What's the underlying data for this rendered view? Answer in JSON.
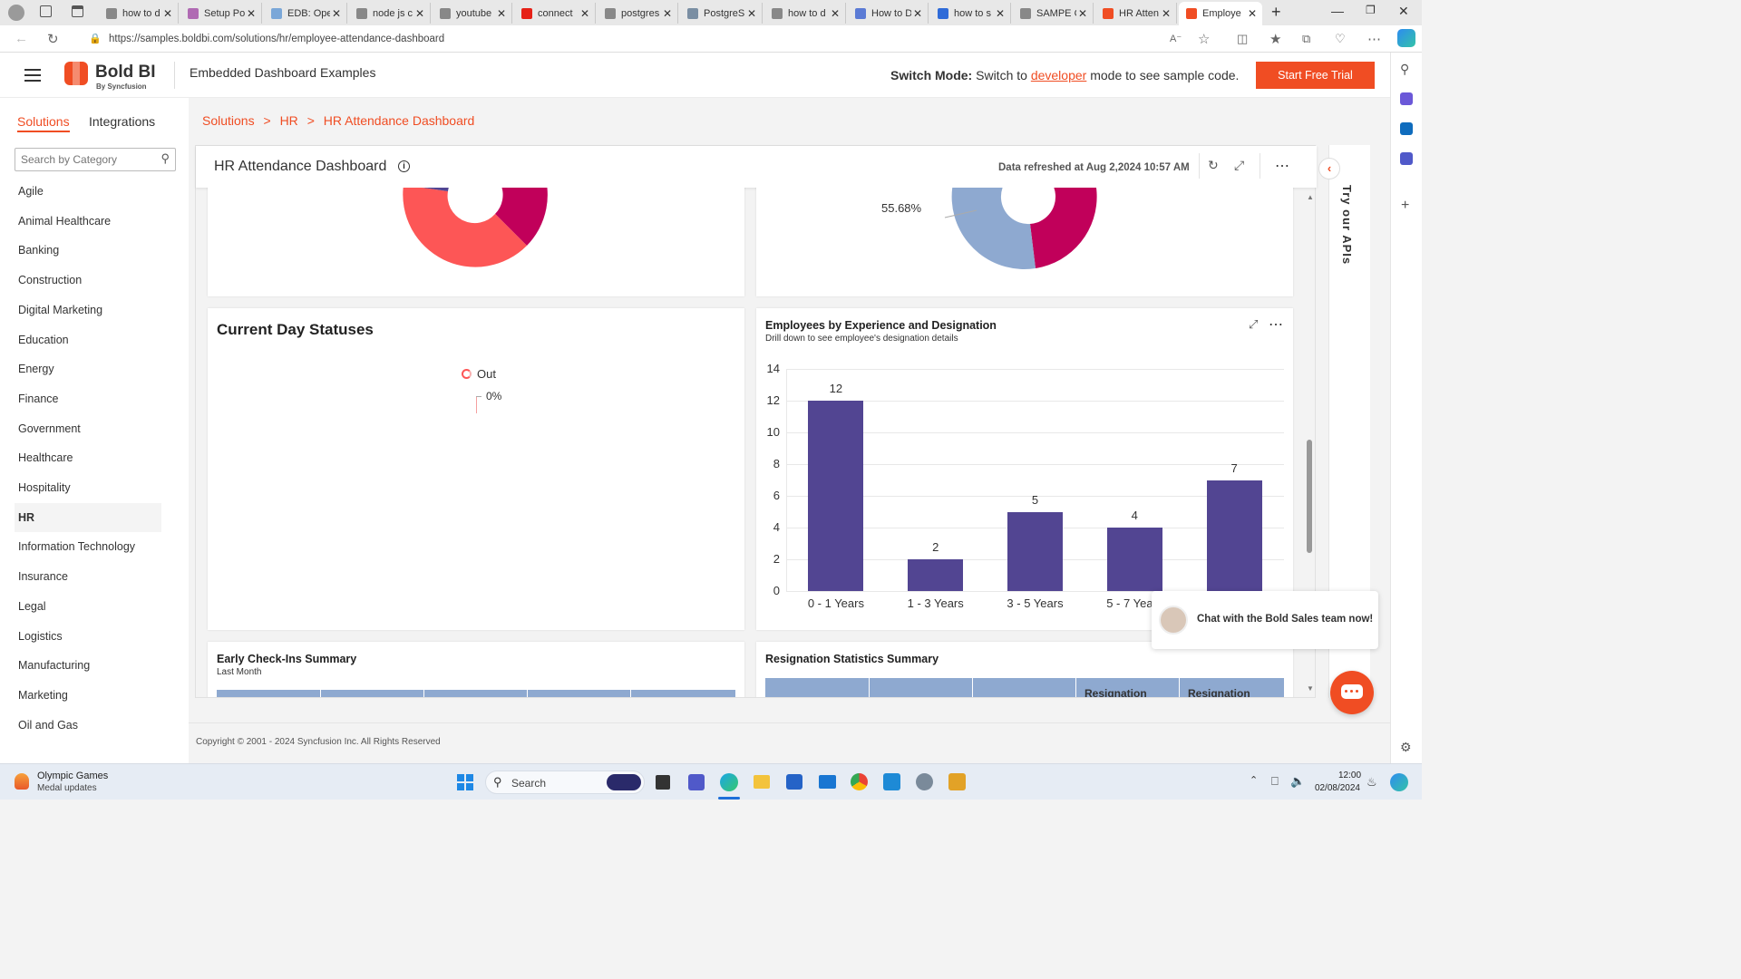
{
  "browser": {
    "tabs": [
      {
        "title": "how to d",
        "color": "#888"
      },
      {
        "title": "Setup Po",
        "color": "#b06ab3"
      },
      {
        "title": "EDB: Ope",
        "color": "#7aa7d8"
      },
      {
        "title": "node js c",
        "color": "#888"
      },
      {
        "title": "youtube",
        "color": "#888"
      },
      {
        "title": "connect",
        "color": "#e62117"
      },
      {
        "title": "postgres",
        "color": "#888"
      },
      {
        "title": "PostgreS",
        "color": "#7a8ea3"
      },
      {
        "title": "how to d",
        "color": "#888"
      },
      {
        "title": "How to D",
        "color": "#5b7bd5"
      },
      {
        "title": "how to s",
        "color": "#2f6bd8"
      },
      {
        "title": "SAMPE C",
        "color": "#888"
      },
      {
        "title": "HR Atten",
        "color": "#f04d23"
      },
      {
        "title": "Employe",
        "color": "#f04d23"
      }
    ],
    "url": "https://samples.boldbi.com/solutions/hr/employee-attendance-dashboard"
  },
  "header": {
    "brand": "Bold BI",
    "brand_sub": "By Syncfusion",
    "title": "Embedded Dashboard Examples",
    "switch_label": "Switch Mode:",
    "switch_pre": "Switch to",
    "switch_link": "developer",
    "switch_post": "mode to see sample code.",
    "cta": "Start Free Trial"
  },
  "sidebar": {
    "tabs": [
      "Solutions",
      "Integrations"
    ],
    "search_placeholder": "Search by Category",
    "items": [
      "Agile",
      "Animal Healthcare",
      "Banking",
      "Construction",
      "Digital Marketing",
      "Education",
      "Energy",
      "Finance",
      "Government",
      "Healthcare",
      "Hospitality",
      "HR",
      "Information Technology",
      "Insurance",
      "Legal",
      "Logistics",
      "Manufacturing",
      "Marketing",
      "Oil and Gas"
    ],
    "active_index": 11
  },
  "breadcrumb": {
    "items": [
      "Solutions",
      "HR",
      "HR Attendance Dashboard"
    ],
    "sep": ">"
  },
  "dashboard": {
    "title": "HR Attendance Dashboard",
    "refreshed": "Data refreshed at Aug 2,2024 10:57 AM",
    "side_tab": "Try our APIs",
    "right_donut_label": "55.68%",
    "current_day": {
      "title": "Current Day Statuses",
      "legend": "Out",
      "value": "0%"
    },
    "experience": {
      "title": "Employees by Experience and Designation",
      "subtitle": "Drill down to see employee's designation details"
    },
    "early_checkins": {
      "title": "Early Check-Ins Summary",
      "subtitle": "Last Month"
    },
    "resignation": {
      "title": "Resignation Statistics Summary",
      "col4": "Resignation",
      "col5": "Resignation"
    },
    "chat": "Chat with the Bold Sales team now!",
    "footer": "Copyright © 2001 - 2024 Syncfusion Inc. All Rights Reserved"
  },
  "taskbar": {
    "news_title": "Olympic Games",
    "news_sub": "Medal updates",
    "search": "Search",
    "time": "12:00",
    "date": "02/08/2024"
  },
  "colors": {
    "accent": "#f04d23",
    "bar": "#524592",
    "donut_red": "#fd5656",
    "donut_crimson": "#c1005a",
    "donut_purple": "#524592",
    "donut_blue": "#8ea9d0"
  },
  "chart_data": {
    "type": "bar",
    "categories": [
      "0 - 1 Years",
      "1 - 3 Years",
      "3 - 5 Years",
      "5 - 7 Years",
      ""
    ],
    "values": [
      12,
      2,
      5,
      4,
      7
    ],
    "ylim": [
      0,
      14
    ],
    "yticks": [
      0,
      2,
      4,
      6,
      8,
      10,
      12,
      14
    ],
    "xlabel": "",
    "ylabel": "",
    "grid": true
  }
}
